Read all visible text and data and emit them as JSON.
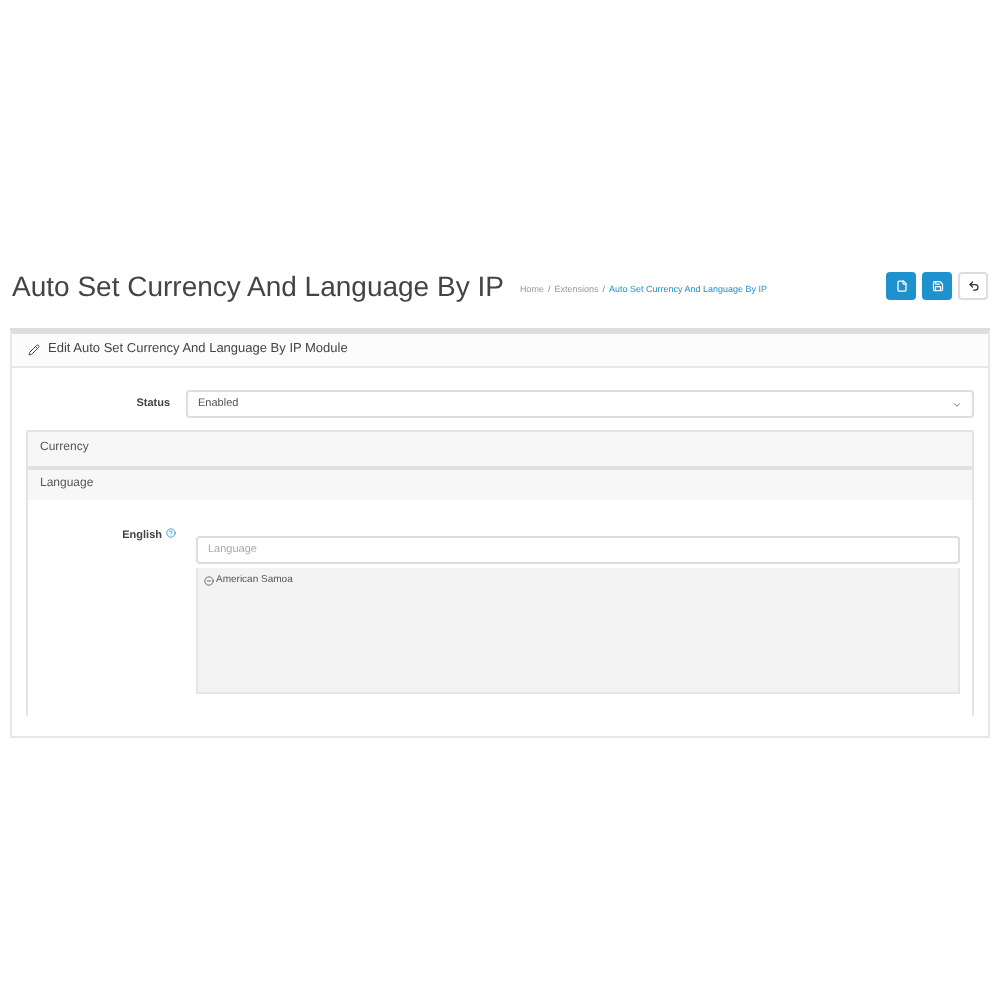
{
  "page": {
    "title": "Auto Set Currency And Language By IP"
  },
  "breadcrumbs": {
    "separator": "/",
    "items": [
      {
        "label": "Home",
        "current": false
      },
      {
        "label": "Extensions",
        "current": false
      },
      {
        "label": "Auto Set Currency And Language By IP",
        "current": true
      }
    ]
  },
  "toolbar": [
    {
      "kind": "primary"
    },
    {
      "kind": "primary"
    },
    {
      "kind": "default"
    }
  ],
  "panel": {
    "heading": "Edit Auto Set Currency And Language By IP Module"
  },
  "status": {
    "label": "Status",
    "value": "Enabled"
  },
  "sections": [
    {
      "label": "Currency"
    },
    {
      "label": "Language",
      "rows": [
        {
          "label": "English",
          "placeholder": "Language",
          "items": [
            "American Samoa"
          ]
        }
      ]
    }
  ]
}
